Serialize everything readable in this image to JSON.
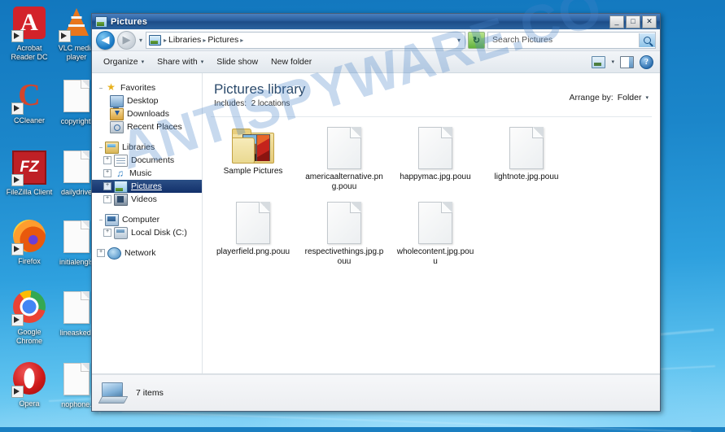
{
  "desktop": {
    "icons": [
      {
        "label": "Acrobat Reader DC",
        "icon": "acrobat-reader-icon",
        "kind": "app",
        "shortcut": true
      },
      {
        "label": "VLC media player",
        "icon": "vlc-media-player-icon",
        "kind": "app",
        "shortcut": true
      },
      {
        "label": "CCleaner",
        "icon": "ccleaner-icon",
        "kind": "app",
        "shortcut": true
      },
      {
        "label": "copyrightl",
        "icon": "encrypted-file-icon",
        "kind": "file",
        "shortcut": false
      },
      {
        "label": "FileZilla Client",
        "icon": "filezilla-icon",
        "kind": "app",
        "shortcut": true
      },
      {
        "label": "dailydrive",
        "icon": "encrypted-file-icon",
        "kind": "file",
        "shortcut": false
      },
      {
        "label": "Firefox",
        "icon": "firefox-icon",
        "kind": "app",
        "shortcut": true
      },
      {
        "label": "initialengls",
        "icon": "encrypted-file-icon",
        "kind": "file",
        "shortcut": false
      },
      {
        "label": "Google Chrome",
        "icon": "chrome-icon",
        "kind": "app",
        "shortcut": true
      },
      {
        "label": "lineasked.",
        "icon": "encrypted-file-icon",
        "kind": "file",
        "shortcut": false
      },
      {
        "label": "Opera",
        "icon": "opera-icon",
        "kind": "app",
        "shortcut": true
      },
      {
        "label": "nophone.",
        "icon": "encrypted-file-icon",
        "kind": "file",
        "shortcut": false
      }
    ]
  },
  "window": {
    "title": "Pictures",
    "buttons": {
      "minimize": "_",
      "maximize": "□",
      "close": "✕"
    }
  },
  "addressbar": {
    "back": "◀",
    "forward": "▶",
    "recent_caret": "▾",
    "crumbs": [
      "Libraries",
      "Pictures"
    ],
    "separator": "▸",
    "dropdown_caret": "▾",
    "refresh": "↻",
    "search_placeholder": "Search Pictures"
  },
  "toolbar": {
    "organize": "Organize",
    "share_with": "Share with",
    "slide_show": "Slide show",
    "new_folder": "New folder",
    "caret": "▾",
    "view_icon": "change-view-icon",
    "view_caret": "▾",
    "preview_pane_icon": "preview-pane-icon",
    "help_icon": "help-icon",
    "help_glyph": "?"
  },
  "navpane": {
    "groups": [
      {
        "header": {
          "label": "Favorites",
          "icon": "favorites-star-icon",
          "expander": "−"
        },
        "items": [
          {
            "label": "Desktop",
            "icon": "desktop-icon",
            "expander": ""
          },
          {
            "label": "Downloads",
            "icon": "downloads-icon",
            "expander": ""
          },
          {
            "label": "Recent Places",
            "icon": "recent-places-icon",
            "expander": ""
          }
        ]
      },
      {
        "header": {
          "label": "Libraries",
          "icon": "libraries-icon",
          "expander": "−"
        },
        "items": [
          {
            "label": "Documents",
            "icon": "documents-icon",
            "expander": "+"
          },
          {
            "label": "Music",
            "icon": "music-icon",
            "expander": "+"
          },
          {
            "label": "Pictures",
            "icon": "pictures-icon",
            "expander": "+",
            "selected": true
          },
          {
            "label": "Videos",
            "icon": "videos-icon",
            "expander": "+"
          }
        ]
      },
      {
        "header": {
          "label": "Computer",
          "icon": "computer-icon",
          "expander": "−"
        },
        "items": [
          {
            "label": "Local Disk (C:)",
            "icon": "local-disk-icon",
            "expander": "+"
          }
        ]
      },
      {
        "header": {
          "label": "Network",
          "icon": "network-icon",
          "expander": "+"
        },
        "items": []
      }
    ]
  },
  "library": {
    "title": "Pictures library",
    "subtitle_label": "Includes:",
    "subtitle_value": "2 locations",
    "arrange_label": "Arrange by:",
    "arrange_value": "Folder",
    "arrange_caret": "▾"
  },
  "files": [
    {
      "name": "Sample Pictures",
      "type": "folder"
    },
    {
      "name": "americaalternative.png.pouu",
      "type": "file"
    },
    {
      "name": "happymac.jpg.pouu",
      "type": "file"
    },
    {
      "name": "lightnote.jpg.pouu",
      "type": "file"
    },
    {
      "name": "playerfield.png.pouu",
      "type": "file"
    },
    {
      "name": "respectivethings.jpg.pouu",
      "type": "file"
    },
    {
      "name": "wholecontent.jpg.pouu",
      "type": "file"
    }
  ],
  "statusbar": {
    "icon": "computer-status-icon",
    "text": "7 items"
  },
  "watermark": {
    "text": "ANTISPYWARE.CO"
  },
  "colors": {
    "titlebar": "#1d4d88",
    "selection": "#12306a",
    "desktop": "#1b86ca",
    "library_title": "#2b4a6b",
    "watermark": "#4682c8"
  }
}
